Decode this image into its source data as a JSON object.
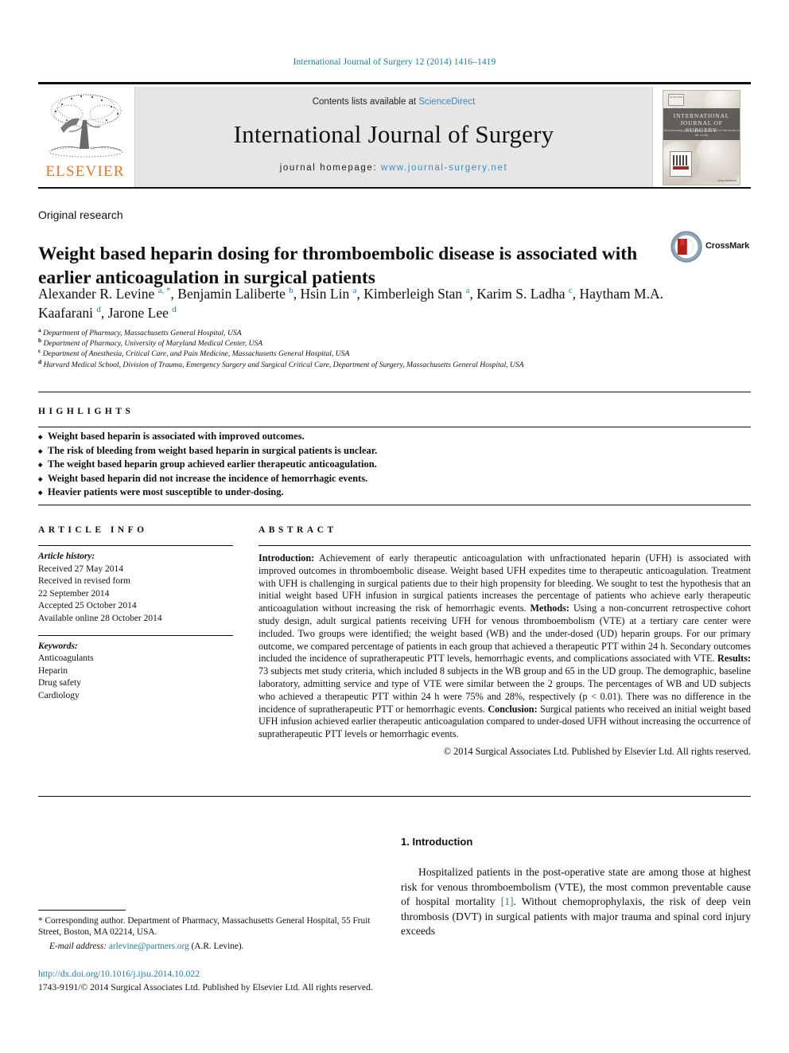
{
  "running_head": "International Journal of Surgery 12 (2014) 1416–1419",
  "masthead": {
    "contents_prefix": "Contents lists available at ",
    "sciencedirect": "ScienceDirect",
    "journal_title": "International Journal of Surgery",
    "homepage_prefix": "journal homepage: ",
    "homepage_url": "www.journal-surgery.net",
    "publisher_wordmark": "ELSEVIER",
    "cover": {
      "line1": "INTERNATIONAL",
      "line2": "JOURNAL OF SURGERY",
      "subtitle": "Incorporating global surgery and\nsurgical education in the world",
      "badge": "ELSEVIER",
      "footer": "Now Indexed"
    },
    "accent_link_color": "#3c8bbd"
  },
  "article": {
    "type": "Original research",
    "title": "Weight based heparin dosing for thromboembolic disease is associated with earlier anticoagulation in surgical patients",
    "crossmark_label": "CrossMark",
    "authors": [
      {
        "name": "Alexander R. Levine",
        "marks": "a, *",
        "sep": ", "
      },
      {
        "name": "Benjamin Laliberte",
        "marks": "b",
        "sep": ", "
      },
      {
        "name": "Hsin Lin",
        "marks": "a",
        "sep": ", "
      },
      {
        "name": "Kimberleigh Stan",
        "marks": "a",
        "sep": ", "
      },
      {
        "name": "Karim S. Ladha",
        "marks": "c",
        "sep": ", "
      },
      {
        "name": "Haytham M.A. Kaafarani",
        "marks": "d",
        "sep": ", "
      },
      {
        "name": "Jarone Lee",
        "marks": "d",
        "sep": ""
      }
    ],
    "affiliations": [
      {
        "mark": "a",
        "text": "Department of Pharmacy, Massachusetts General Hospital, USA"
      },
      {
        "mark": "b",
        "text": "Department of Pharmacy, University of Maryland Medical Center, USA"
      },
      {
        "mark": "c",
        "text": "Department of Anesthesia, Critical Care, and Pain Medicine, Massachusetts General Hospital, USA"
      },
      {
        "mark": "d",
        "text": "Harvard Medical School, Division of Trauma, Emergency Surgery and Surgical Critical Care, Department of Surgery, Massachusetts General Hospital, USA"
      }
    ]
  },
  "highlights": {
    "heading": "HIGHLIGHTS",
    "items": [
      "Weight based heparin is associated with improved outcomes.",
      "The risk of bleeding from weight based heparin in surgical patients is unclear.",
      "The weight based heparin group achieved earlier therapeutic anticoagulation.",
      "Weight based heparin did not increase the incidence of hemorrhagic events.",
      "Heavier patients were most susceptible to under-dosing."
    ]
  },
  "article_info": {
    "heading": "ARTICLE INFO",
    "history_label": "Article history:",
    "history": [
      "Received 27 May 2014",
      "Received in revised form",
      "22 September 2014",
      "Accepted 25 October 2014",
      "Available online 28 October 2014"
    ],
    "keywords_label": "Keywords:",
    "keywords": [
      "Anticoagulants",
      "Heparin",
      "Drug safety",
      "Cardiology"
    ]
  },
  "abstract": {
    "heading": "ABSTRACT",
    "sections": [
      {
        "label": "Introduction:",
        "text": " Achievement of early therapeutic anticoagulation with unfractionated heparin (UFH) is associated with improved outcomes in thromboembolic disease. Weight based UFH expedites time to therapeutic anticoagulation. Treatment with UFH is challenging in surgical patients due to their high propensity for bleeding. We sought to test the hypothesis that an initial weight based UFH infusion in surgical patients increases the percentage of patients who achieve early therapeutic anticoagulation without increasing the risk of hemorrhagic events. "
      },
      {
        "label": "Methods:",
        "text": " Using a non-concurrent retrospective cohort study design, adult surgical patients receiving UFH for venous thromboembolism (VTE) at a tertiary care center were included. Two groups were identified; the weight based (WB) and the under-dosed (UD) heparin groups. For our primary outcome, we compared percentage of patients in each group that achieved a therapeutic PTT within 24 h. Secondary outcomes included the incidence of supratherapeutic PTT levels, hemorrhagic events, and complications associated with VTE. "
      },
      {
        "label": "Results:",
        "text": " 73 subjects met study criteria, which included 8 subjects in the WB group and 65 in the UD group. The demographic, baseline laboratory, admitting service and type of VTE were similar between the 2 groups. The percentages of WB and UD subjects who achieved a therapeutic PTT within 24 h were 75% and 28%, respectively (p < 0.01). There was no difference in the incidence of supratherapeutic PTT or hemorrhagic events. "
      },
      {
        "label": "Conclusion:",
        "text": " Surgical patients who received an initial weight based UFH infusion achieved earlier therapeutic anticoagulation compared to under-dosed UFH without increasing the occurrence of supratherapeutic PTT levels or hemorrhagic events."
      }
    ],
    "copyright": "© 2014 Surgical Associates Ltd. Published by Elsevier Ltd. All rights reserved."
  },
  "introduction": {
    "heading": "1. Introduction",
    "paragraph_pre": "Hospitalized patients in the post-operative state are among those at highest risk for venous thromboembolism (VTE), the most common preventable cause of hospital mortality ",
    "reference": "[1]",
    "paragraph_post": ". Without chemoprophylaxis, the risk of deep vein thrombosis (DVT) in surgical patients with major trauma and spinal cord injury exceeds"
  },
  "footer": {
    "corresponding_marker": "*",
    "corresponding_text": " Corresponding author. Department of Pharmacy, Massachusetts General Hospital, 55 Fruit Street, Boston, MA 02214, USA.",
    "email_label": "E-mail address:",
    "email_address": "arlevine@partners.org",
    "email_attribution": "(A.R. Levine).",
    "doi_url": "http://dx.doi.org/10.1016/j.ijsu.2014.10.022",
    "issn_line": "1743-9191/© 2014 Surgical Associates Ltd. Published by Elsevier Ltd. All rights reserved."
  }
}
